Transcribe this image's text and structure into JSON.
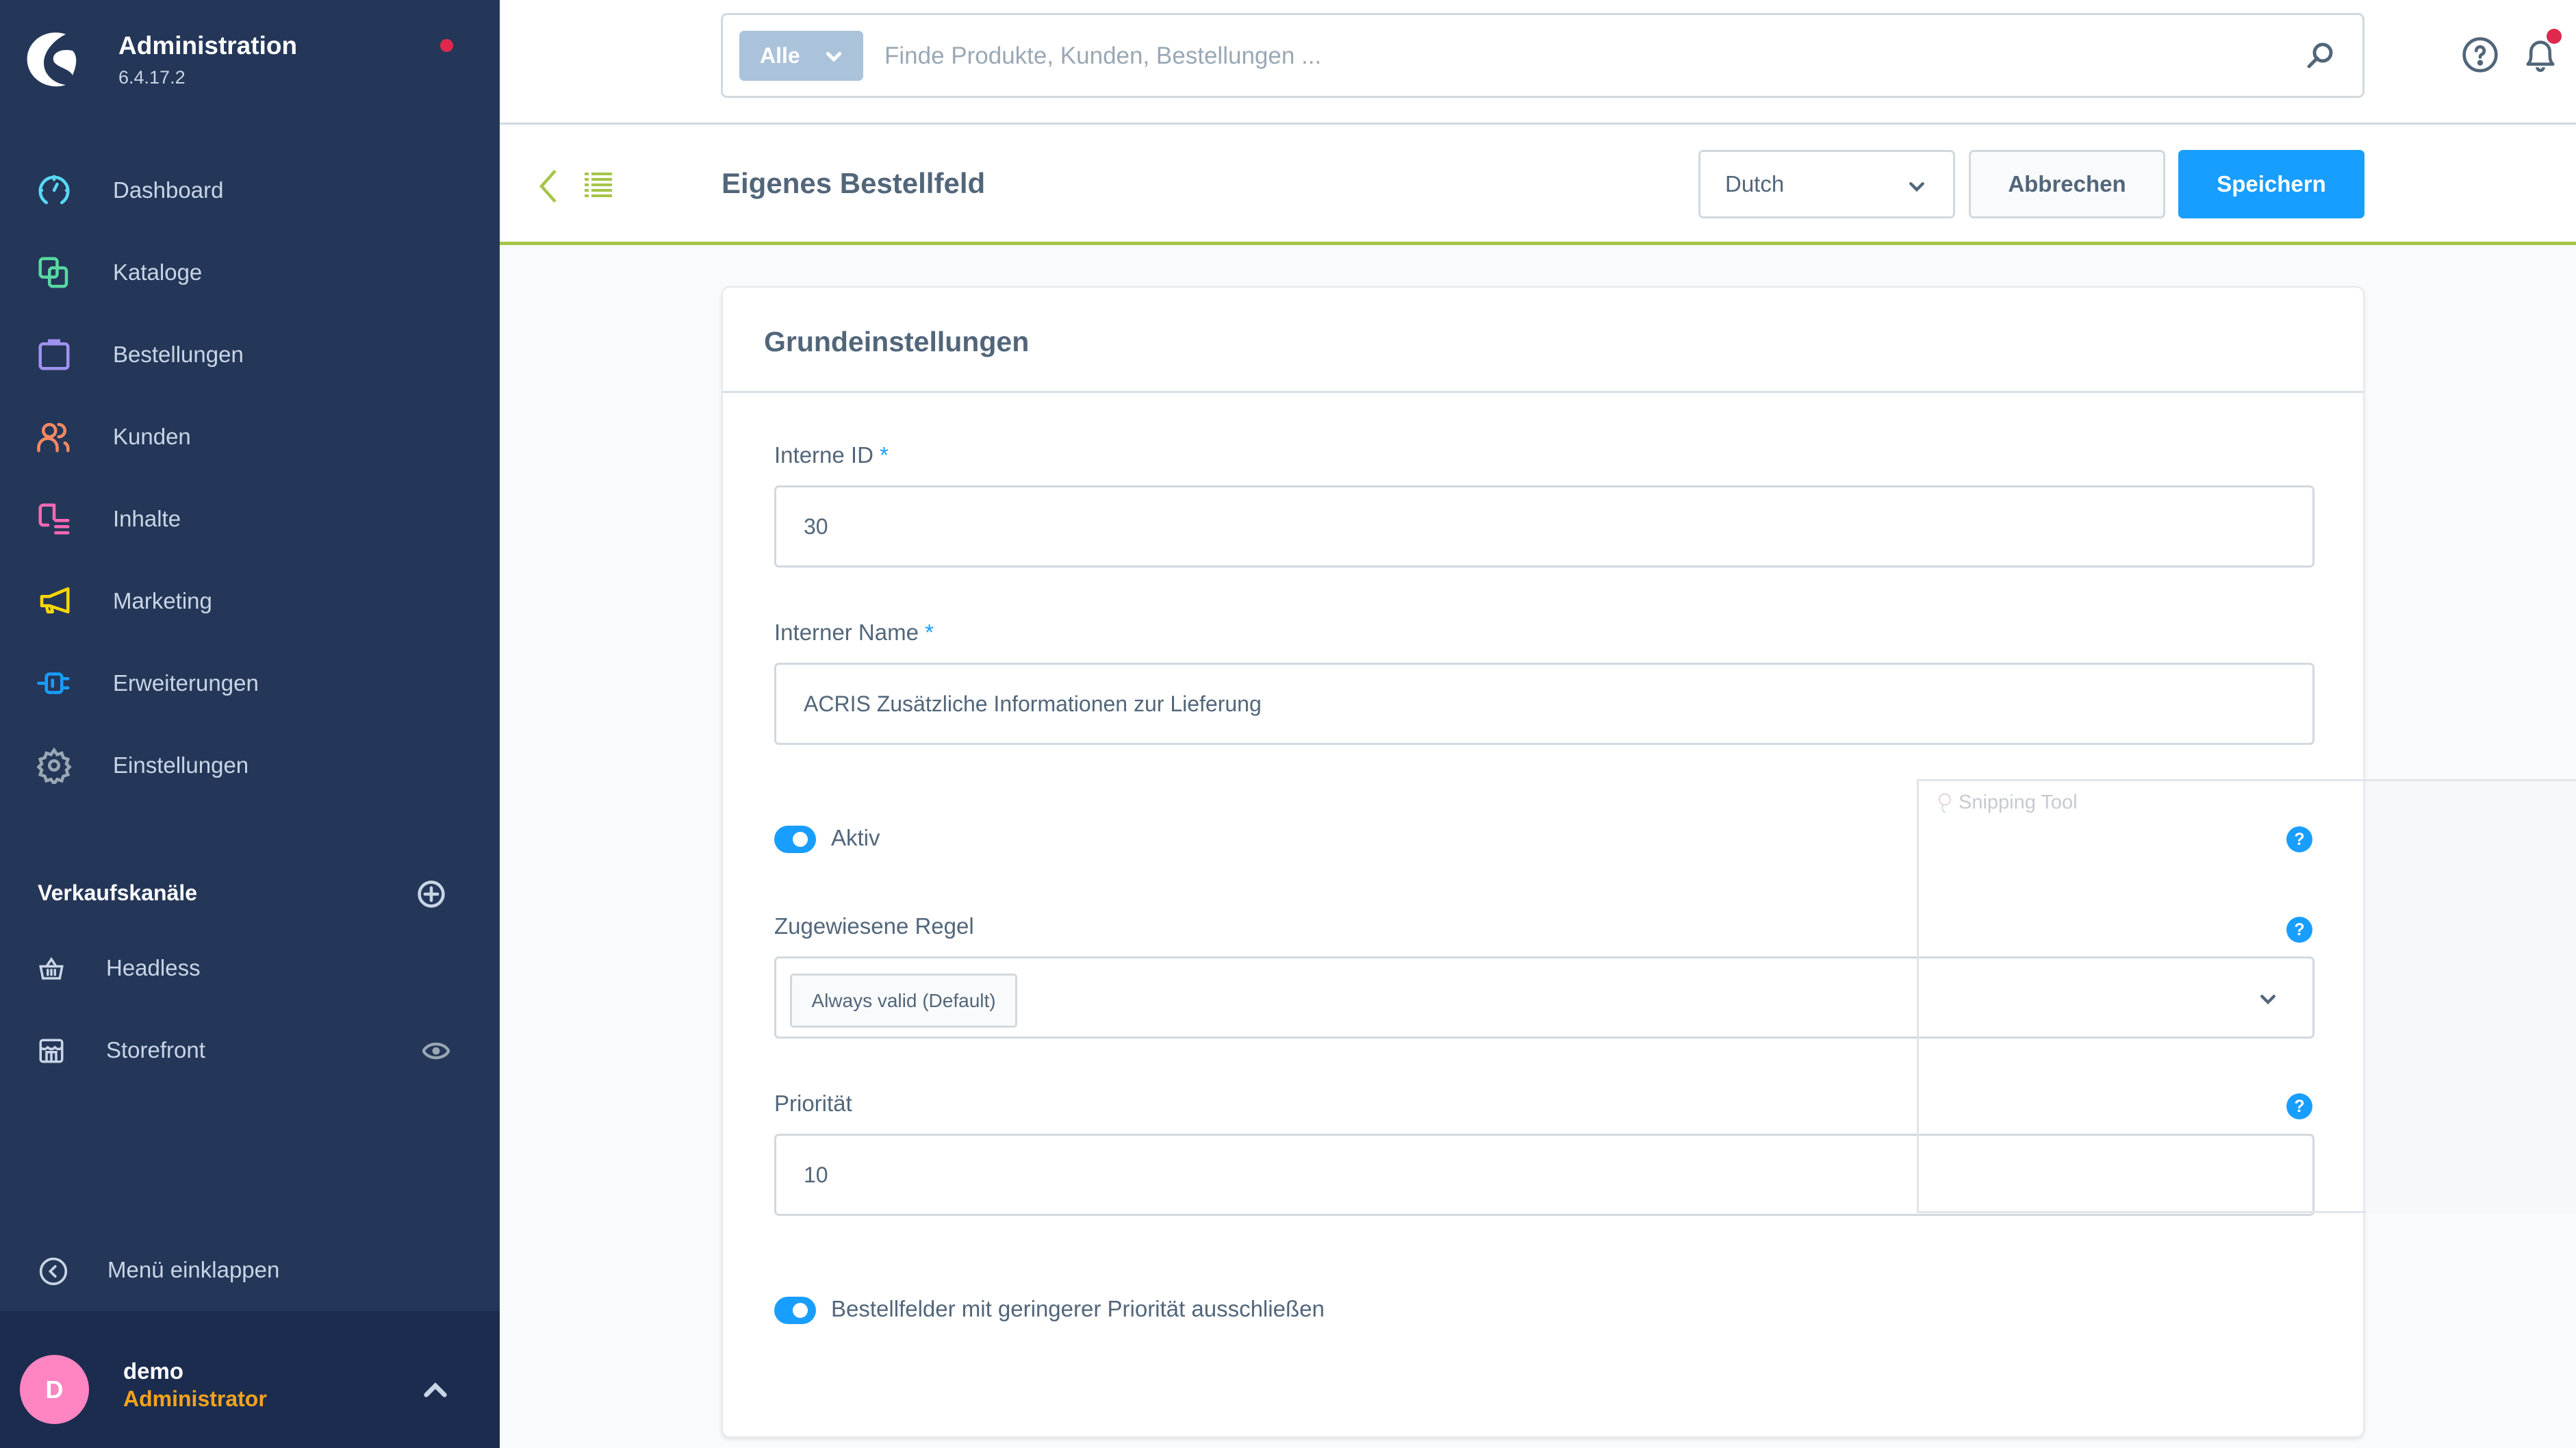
{
  "app": {
    "title": "Administration",
    "version": "6.4.17.2",
    "colors": {
      "sidebar_bg": "#243758",
      "accent": "#189eff",
      "header_line": "#a5c547",
      "notification": "#de294c",
      "role": "#f4a31c",
      "avatar": "#ff85c2"
    }
  },
  "sidebar": {
    "items": [
      {
        "label": "Dashboard",
        "icon": "gauge-icon",
        "color": "#57d9f4"
      },
      {
        "label": "Kataloge",
        "icon": "catalog-icon",
        "color": "#57d9a3"
      },
      {
        "label": "Bestellungen",
        "icon": "shopping-bag-icon",
        "color": "#a092f0"
      },
      {
        "label": "Kunden",
        "icon": "users-icon",
        "color": "#f88962"
      },
      {
        "label": "Inhalte",
        "icon": "content-icon",
        "color": "#ff68b4"
      },
      {
        "label": "Marketing",
        "icon": "megaphone-icon",
        "color": "#ffd700"
      },
      {
        "label": "Erweiterungen",
        "icon": "plug-icon",
        "color": "#189eff"
      },
      {
        "label": "Einstellungen",
        "icon": "gear-icon",
        "color": "#9aa8b5"
      }
    ],
    "sales_channels": {
      "title": "Verkaufskanäle",
      "items": [
        {
          "label": "Headless",
          "icon": "basket-icon"
        },
        {
          "label": "Storefront",
          "icon": "storefront-icon"
        }
      ]
    },
    "collapse_label": "Menü einklappen",
    "user": {
      "initial": "D",
      "name": "demo",
      "role": "Administrator"
    }
  },
  "topbar": {
    "search_type": "Alle",
    "search_placeholder": "Finde Produkte, Kunden, Bestellungen ..."
  },
  "page": {
    "title": "Eigenes Bestellfeld",
    "language": "Dutch",
    "cancel_label": "Abbrechen",
    "save_label": "Speichern"
  },
  "card": {
    "title": "Grundeinstellungen",
    "fields": {
      "internal_id": {
        "label": "Interne ID",
        "required": "*",
        "value": "30"
      },
      "internal_name": {
        "label": "Interner Name",
        "required": "*",
        "value": "ACRIS Zusätzliche Informationen zur Lieferung"
      },
      "active": {
        "label": "Aktiv",
        "checked": true
      },
      "rule": {
        "label": "Zugewiesene Regel",
        "value": "Always valid (Default)"
      },
      "priority": {
        "label": "Priorität",
        "value": "10"
      },
      "exclude_lower": {
        "label": "Bestellfelder mit geringerer Priorität ausschließen",
        "checked": true
      }
    },
    "help_marker": "?"
  },
  "overlay": {
    "label": "Snipping Tool"
  }
}
